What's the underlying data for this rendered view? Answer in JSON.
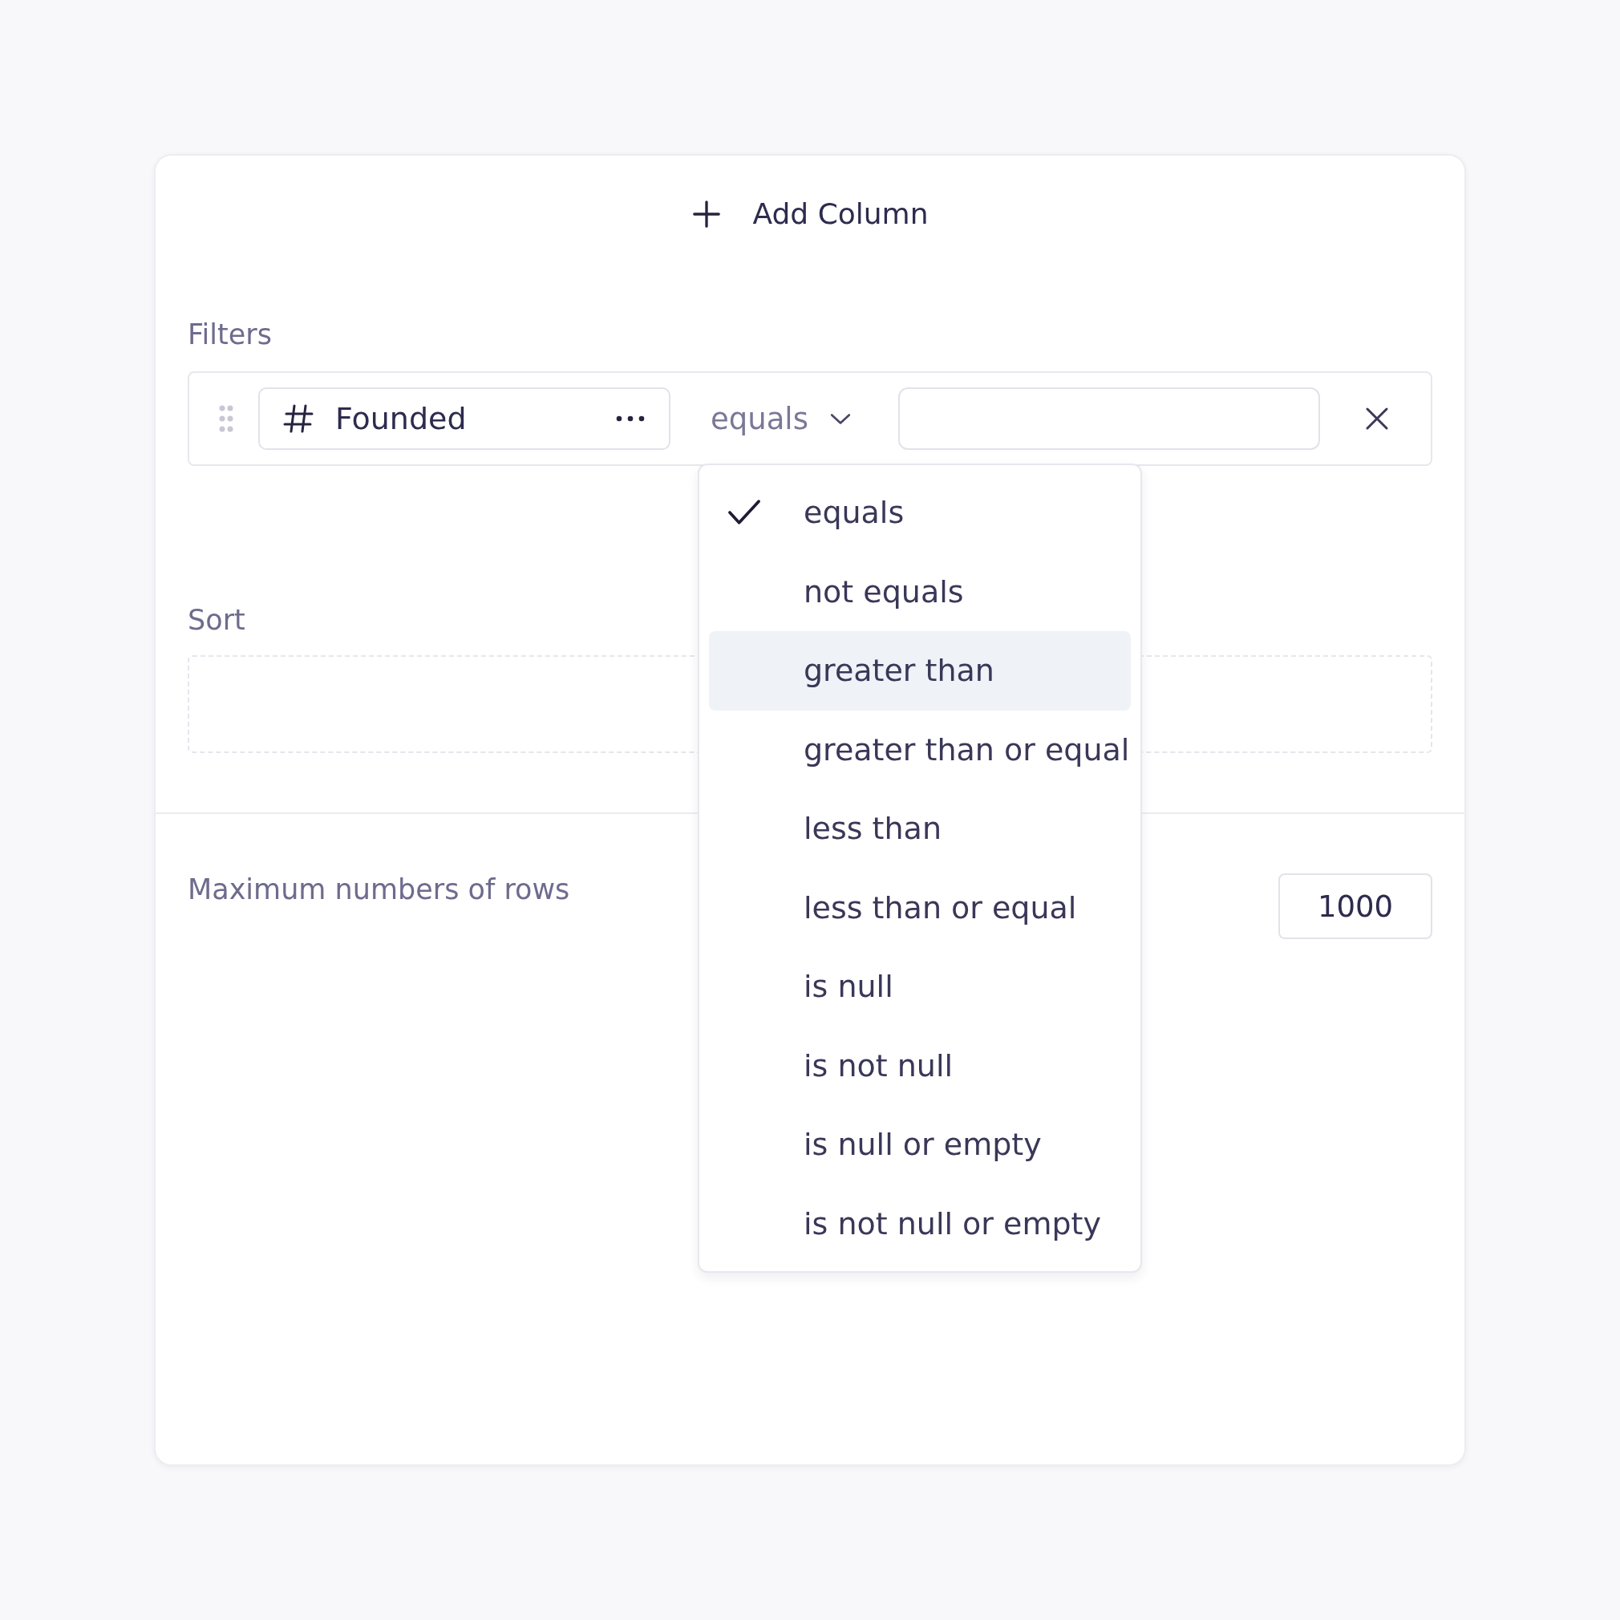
{
  "add_column": {
    "label": "Add Column"
  },
  "filters": {
    "title": "Filters",
    "rows": [
      {
        "column": "Founded",
        "operator": "equals",
        "value_placeholder": ""
      }
    ]
  },
  "operator_menu": {
    "items": [
      {
        "label": "equals",
        "selected": true,
        "highlighted": false
      },
      {
        "label": "not equals",
        "selected": false,
        "highlighted": false
      },
      {
        "label": "greater than",
        "selected": false,
        "highlighted": true
      },
      {
        "label": "greater than or equal",
        "selected": false,
        "highlighted": false
      },
      {
        "label": "less than",
        "selected": false,
        "highlighted": false
      },
      {
        "label": "less than or equal",
        "selected": false,
        "highlighted": false
      },
      {
        "label": "is null",
        "selected": false,
        "highlighted": false
      },
      {
        "label": "is not null",
        "selected": false,
        "highlighted": false
      },
      {
        "label": "is null or empty",
        "selected": false,
        "highlighted": false
      },
      {
        "label": "is not null or empty",
        "selected": false,
        "highlighted": false
      }
    ]
  },
  "sort": {
    "title": "Sort"
  },
  "max_rows": {
    "label": "Maximum numbers of rows",
    "value": "1000"
  }
}
